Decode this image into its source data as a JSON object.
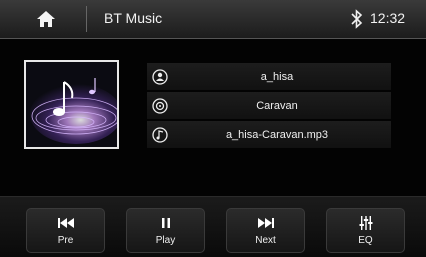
{
  "header": {
    "title": "BT Music",
    "time": "12:32",
    "home_icon": "home-icon",
    "bluetooth_icon": "bluetooth-icon"
  },
  "track": {
    "artist": "a_hisa",
    "album": "Caravan",
    "file": "a_hisa-Caravan.mp3",
    "artist_icon": "person-icon",
    "album_icon": "disc-icon",
    "file_icon": "music-note-icon"
  },
  "controls": [
    {
      "label": "Pre",
      "icon": "previous-icon"
    },
    {
      "label": "Play",
      "icon": "pause-icon"
    },
    {
      "label": "Next",
      "icon": "next-icon"
    },
    {
      "label": "EQ",
      "icon": "equalizer-icon"
    }
  ],
  "colors": {
    "background": "#050505",
    "text": "#f2f2f2",
    "button": "#222222"
  }
}
